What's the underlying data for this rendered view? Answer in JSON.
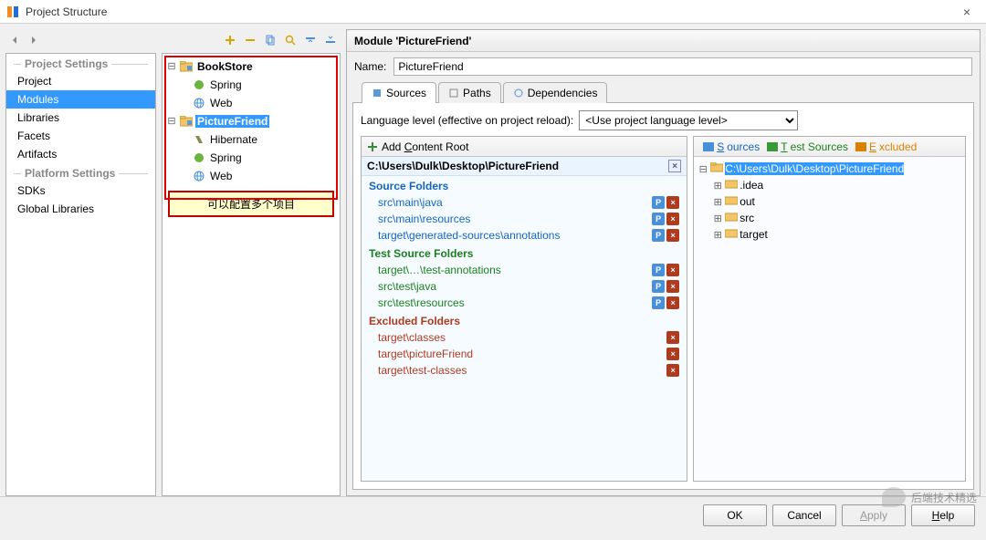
{
  "window": {
    "title": "Project Structure",
    "close_glyph": "×"
  },
  "sidebar": {
    "project_head": "Project Settings",
    "platform_head": "Platform Settings",
    "project_items": [
      "Project",
      "Modules",
      "Libraries",
      "Facets",
      "Artifacts"
    ],
    "platform_items": [
      "SDKs",
      "Global Libraries"
    ],
    "selected": "Modules"
  },
  "mid_toolbar_icons": [
    "plus-icon",
    "minus-icon",
    "copy-icon",
    "search-icon",
    "select-all-icon",
    "deselect-icon"
  ],
  "module_tree": [
    {
      "name": "BookStore",
      "kind": "module",
      "children": [
        {
          "name": "Spring",
          "kind": "spring"
        },
        {
          "name": "Web",
          "kind": "web"
        }
      ]
    },
    {
      "name": "PictureFriend",
      "kind": "module",
      "selected": true,
      "children": [
        {
          "name": "Hibernate",
          "kind": "hibernate"
        },
        {
          "name": "Spring",
          "kind": "spring"
        },
        {
          "name": "Web",
          "kind": "web"
        }
      ]
    }
  ],
  "annotation": "可以配置多个项目",
  "detail": {
    "header": "Module 'PictureFriend'",
    "name_label": "Name:",
    "name_value": "PictureFriend",
    "tabs": [
      "Sources",
      "Paths",
      "Dependencies"
    ],
    "active_tab": "Sources",
    "lang_label": "Language level (effective on project reload):",
    "lang_value": "<Use project language level>",
    "content": {
      "add_label": "Add Content Root",
      "root_path": "C:\\Users\\Dulk\\Desktop\\PictureFriend",
      "source_head": "Source Folders",
      "sources": [
        "src\\main\\java",
        "src\\main\\resources",
        "target\\generated-sources\\annotations"
      ],
      "test_head": "Test Source Folders",
      "tests": [
        "target\\…\\test-annotations",
        "src\\test\\java",
        "src\\test\\resources"
      ],
      "excl_head": "Excluded Folders",
      "excluded": [
        "target\\classes",
        "target\\pictureFriend",
        "target\\test-classes"
      ]
    },
    "marks": {
      "sources": "Sources",
      "tests": "Test Sources",
      "excluded": "Excluded"
    },
    "dir_tree": {
      "root": "C:\\Users\\Dulk\\Desktop\\PictureFriend",
      "children": [
        ".idea",
        "out",
        "src",
        "target"
      ]
    }
  },
  "buttons": {
    "ok": "OK",
    "cancel": "Cancel",
    "apply": "Apply",
    "help": "Help",
    "apply_underline": "A",
    "help_underline": "H"
  },
  "watermark": "后端技术精选"
}
